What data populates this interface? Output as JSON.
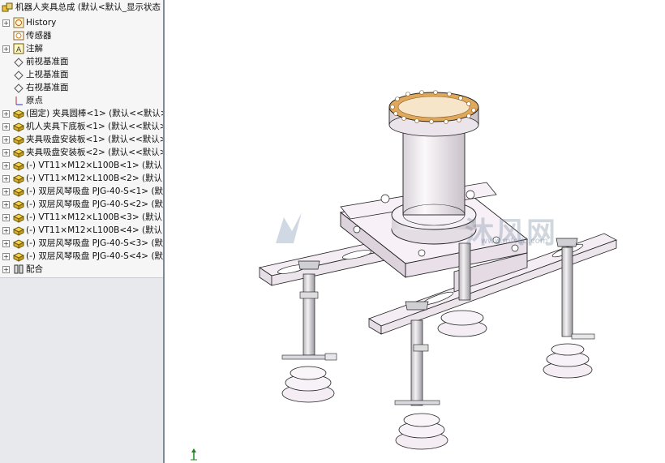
{
  "feature_tree": {
    "root": {
      "label": "机器人夹具总成  (默认<默认_显示状态"
    },
    "items": [
      {
        "label": "History",
        "icon": "history-icon",
        "expander": "+"
      },
      {
        "label": "传感器",
        "icon": "sensor-icon",
        "expander": ""
      },
      {
        "label": "注解",
        "icon": "annotation-icon",
        "expander": "+"
      },
      {
        "label": "前视基准面",
        "icon": "plane-icon",
        "expander": ""
      },
      {
        "label": "上视基准面",
        "icon": "plane-icon",
        "expander": ""
      },
      {
        "label": "右视基准面",
        "icon": "plane-icon",
        "expander": ""
      },
      {
        "label": "原点",
        "icon": "origin-icon",
        "expander": ""
      },
      {
        "label": "(固定) 夹具圆棒<1> (默认<<默认>",
        "icon": "part-icon",
        "expander": "+"
      },
      {
        "label": "机人夹具下底板<1> (默认<<默认>",
        "icon": "part-icon",
        "expander": "+"
      },
      {
        "label": "夹具吸盘安装板<1> (默认<<默认>",
        "icon": "part-icon",
        "expander": "+"
      },
      {
        "label": "夹具吸盘安装板<2> (默认<<默认>",
        "icon": "part-icon",
        "expander": "+"
      },
      {
        "label": "(-) VT11×M12×L100B<1> (默认<",
        "icon": "part-icon",
        "expander": "+"
      },
      {
        "label": "(-) VT11×M12×L100B<2> (默认<",
        "icon": "part-icon",
        "expander": "+"
      },
      {
        "label": "(-) 双层风琴吸盘 PJG-40-S<1> (默",
        "icon": "part-icon",
        "expander": "+"
      },
      {
        "label": "(-) 双层风琴吸盘 PJG-40-S<2> (默",
        "icon": "part-icon",
        "expander": "+"
      },
      {
        "label": "(-) VT11×M12×L100B<3> (默认<",
        "icon": "part-icon",
        "expander": "+"
      },
      {
        "label": "(-) VT11×M12×L100B<4> (默认<",
        "icon": "part-icon",
        "expander": "+"
      },
      {
        "label": "(-) 双层风琴吸盘 PJG-40-S<3> (默",
        "icon": "part-icon",
        "expander": "+"
      },
      {
        "label": "(-) 双层风琴吸盘 PJG-40-S<4> (默",
        "icon": "part-icon",
        "expander": "+"
      },
      {
        "label": "配合",
        "icon": "mates-icon",
        "expander": "+"
      }
    ]
  },
  "watermark": {
    "text": "沐风网",
    "url": "www.mfcad.com"
  },
  "colors": {
    "part_fill": "#f3edf3",
    "bolt_ring": "#e0a85a",
    "edge": "#222222"
  }
}
